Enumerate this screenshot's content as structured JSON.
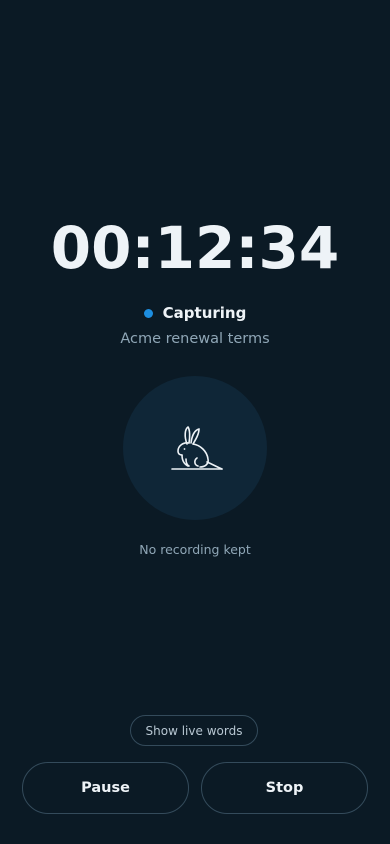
{
  "timer": {
    "elapsed": "00:12:34"
  },
  "status": {
    "label": "Capturing",
    "dot_color": "#1d8ee0"
  },
  "session": {
    "title": "Acme renewal terms"
  },
  "mascot": {
    "icon": "rabbit-icon"
  },
  "privacy": {
    "note": "No recording kept"
  },
  "controls": {
    "live_words_label": "Show live words",
    "pause_label": "Pause",
    "stop_label": "Stop"
  },
  "colors": {
    "background": "#0b1a25",
    "circle": "#0f2637",
    "text_primary": "#eef3f7",
    "text_muted": "#8fa6b6",
    "border": "#344b5b"
  }
}
